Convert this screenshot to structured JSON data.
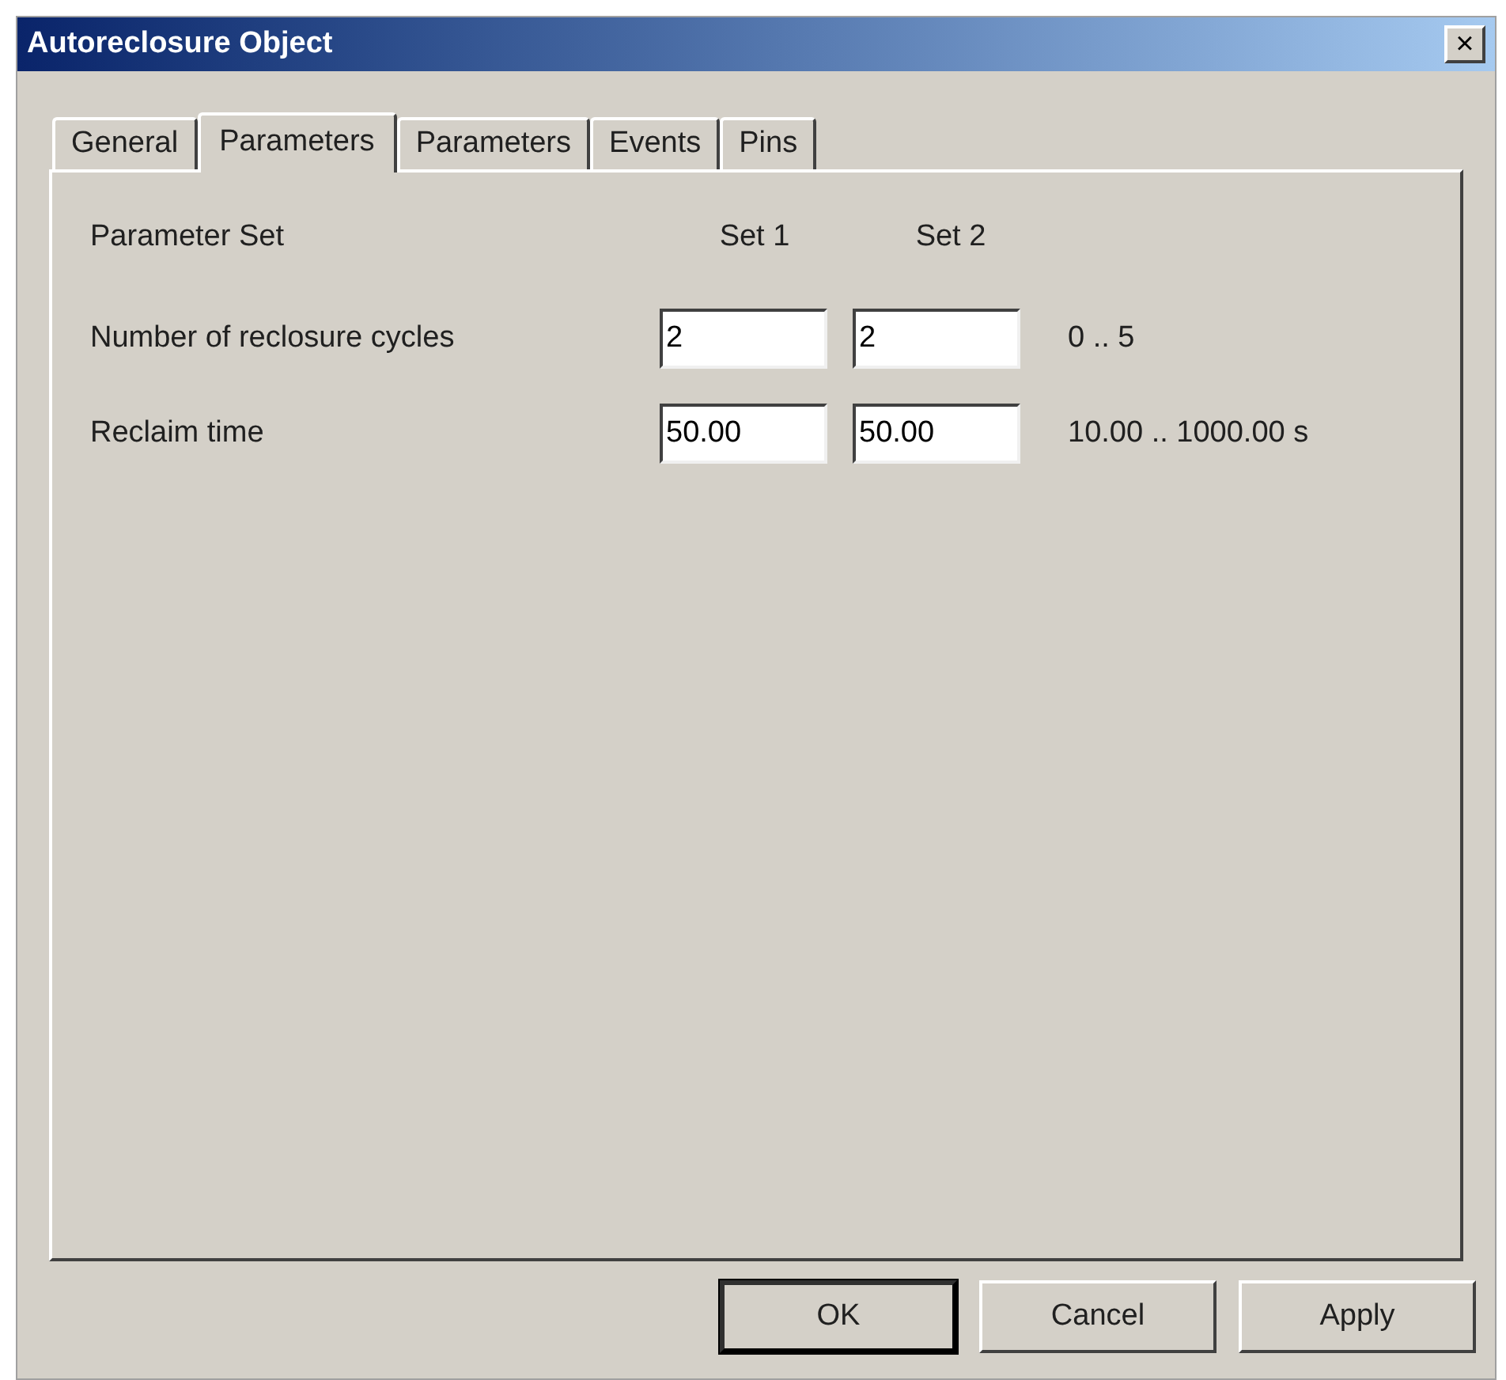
{
  "window": {
    "title": "Autoreclosure Object",
    "close": "×"
  },
  "tabs": [
    {
      "label": "General",
      "selected": false
    },
    {
      "label": "Parameters",
      "selected": true
    },
    {
      "label": "Parameters",
      "selected": false
    },
    {
      "label": "Events",
      "selected": false
    },
    {
      "label": "Pins",
      "selected": false
    }
  ],
  "header": {
    "label": "Parameter Set",
    "columns": [
      "Set 1",
      "Set 2"
    ]
  },
  "parameters": [
    {
      "label": "Number of reclosure cycles",
      "values": [
        "2",
        "2"
      ],
      "range": "0 .. 5"
    },
    {
      "label": "Reclaim time",
      "values": [
        "50.00",
        "50.00"
      ],
      "range": "10.00 .. 1000.00 s"
    }
  ],
  "buttons": [
    {
      "label": "OK",
      "default": true
    },
    {
      "label": "Cancel",
      "default": false
    },
    {
      "label": "Apply",
      "default": false
    }
  ]
}
